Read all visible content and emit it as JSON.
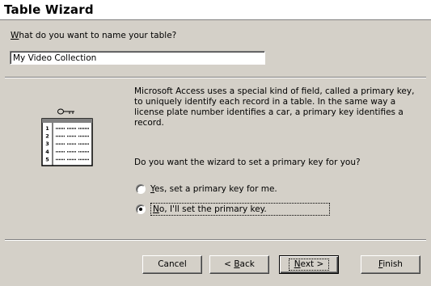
{
  "dialog": {
    "title": "Table Wizard",
    "name_prompt_prefix": "",
    "name_prompt_accel": "W",
    "name_prompt_rest": "hat do you want to name your table?",
    "table_name_value": "My Video Collection",
    "description": "Microsoft Access uses a special kind of field, called a primary key, to uniquely identify each record in a table. In the same way a license plate number identifies a car, a primary key identifies a record.",
    "question": "Do you want the wizard to set a primary key for you?",
    "options": [
      {
        "accel": "Y",
        "rest": "es, set a primary key for me.",
        "selected": false
      },
      {
        "accel": "N",
        "rest": "o, I'll set the primary key.",
        "selected": true
      }
    ]
  },
  "illustration": {
    "icon": "key-icon",
    "row_numbers": [
      "1",
      "2",
      "3",
      "4",
      "5"
    ]
  },
  "buttons": {
    "cancel": "Cancel",
    "back_prefix": "< ",
    "back_accel": "B",
    "back_rest": "ack",
    "next_accel": "N",
    "next_rest": "ext >",
    "finish_accel": "F",
    "finish_rest": "inish"
  }
}
